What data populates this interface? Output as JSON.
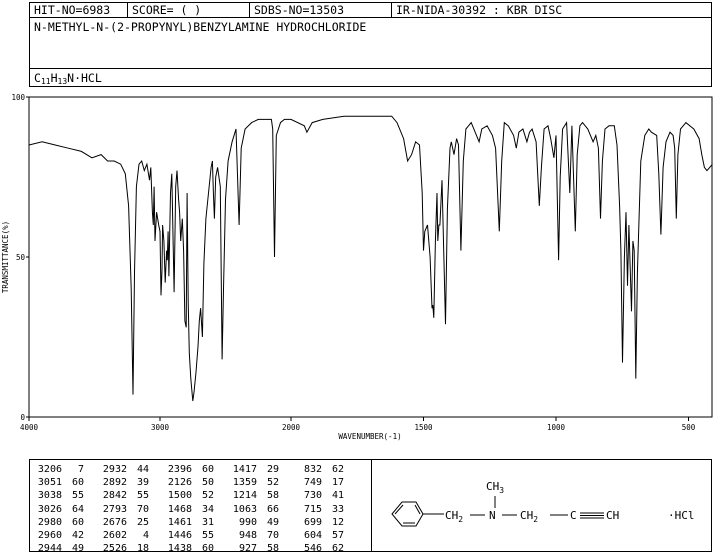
{
  "header": {
    "hit": "HIT-NO=6983",
    "score": "SCORE=  (   )",
    "sdbs": "SDBS-NO=13503",
    "ir": "IR-NIDA-30392 : KBR DISC"
  },
  "compound_name": "N-METHYL-N-(2-PROPYNYL)BENZYLAMINE HYDROCHLORIDE",
  "formula": {
    "c": "C",
    "c_n": "11",
    "h": "H",
    "h_n": "13",
    "rest": "N·HCL"
  },
  "structure": {
    "ch3": "CH",
    "ch3_sub": "3",
    "ch2a": "CH",
    "ch2a_sub": "2",
    "n": "N",
    "ch2b": "CH",
    "ch2b_sub": "2",
    "c": "C",
    "ch": "CH",
    "salt": "·HCl"
  },
  "chart_data": {
    "type": "line",
    "xlabel": "WAVENUMBER(-1)",
    "ylabel": "TRANSMITTANCE(%)",
    "x_ticks": [
      "4000",
      "3000",
      "2000",
      "1500",
      "1000",
      "500"
    ],
    "y_ticks": [
      "100",
      "50",
      "0"
    ],
    "xlim": [
      4000,
      400
    ],
    "ylim": [
      0,
      100
    ],
    "x_scale": "piecewise linear, break at 2000",
    "grid": false,
    "series": [
      {
        "values": [
          [
            4000,
            85
          ],
          [
            3900,
            86
          ],
          [
            3800,
            85
          ],
          [
            3700,
            84
          ],
          [
            3600,
            83
          ],
          [
            3520,
            81
          ],
          [
            3450,
            82
          ],
          [
            3400,
            80
          ],
          [
            3350,
            80
          ],
          [
            3300,
            79
          ],
          [
            3265,
            76
          ],
          [
            3240,
            66
          ],
          [
            3220,
            40
          ],
          [
            3206,
            7
          ],
          [
            3195,
            45
          ],
          [
            3180,
            72
          ],
          [
            3160,
            79
          ],
          [
            3140,
            80
          ],
          [
            3120,
            77
          ],
          [
            3100,
            79
          ],
          [
            3080,
            74
          ],
          [
            3070,
            78
          ],
          [
            3058,
            64
          ],
          [
            3051,
            60
          ],
          [
            3045,
            72
          ],
          [
            3038,
            55
          ],
          [
            3026,
            64
          ],
          [
            3010,
            60
          ],
          [
            3000,
            58
          ],
          [
            2992,
            38
          ],
          [
            2985,
            46
          ],
          [
            2980,
            60
          ],
          [
            2970,
            55
          ],
          [
            2960,
            42
          ],
          [
            2950,
            52
          ],
          [
            2944,
            49
          ],
          [
            2938,
            58
          ],
          [
            2932,
            44
          ],
          [
            2920,
            70
          ],
          [
            2910,
            76
          ],
          [
            2892,
            39
          ],
          [
            2880,
            72
          ],
          [
            2870,
            77
          ],
          [
            2858,
            68
          ],
          [
            2850,
            64
          ],
          [
            2842,
            55
          ],
          [
            2830,
            62
          ],
          [
            2820,
            52
          ],
          [
            2810,
            30
          ],
          [
            2800,
            28
          ],
          [
            2793,
            70
          ],
          [
            2785,
            36
          ],
          [
            2776,
            20
          ],
          [
            2765,
            12
          ],
          [
            2750,
            5
          ],
          [
            2740,
            8
          ],
          [
            2725,
            14
          ],
          [
            2710,
            22
          ],
          [
            2700,
            30
          ],
          [
            2690,
            34
          ],
          [
            2676,
            25
          ],
          [
            2665,
            48
          ],
          [
            2650,
            62
          ],
          [
            2630,
            70
          ],
          [
            2610,
            78
          ],
          [
            2600,
            80
          ],
          [
            2592,
            70
          ],
          [
            2585,
            62
          ],
          [
            2575,
            75
          ],
          [
            2560,
            78
          ],
          [
            2540,
            72
          ],
          [
            2526,
            18
          ],
          [
            2515,
            40
          ],
          [
            2500,
            68
          ],
          [
            2480,
            80
          ],
          [
            2450,
            86
          ],
          [
            2420,
            90
          ],
          [
            2396,
            60
          ],
          [
            2380,
            84
          ],
          [
            2350,
            90
          ],
          [
            2300,
            92
          ],
          [
            2250,
            93
          ],
          [
            2200,
            93
          ],
          [
            2150,
            93
          ],
          [
            2140,
            90
          ],
          [
            2126,
            50
          ],
          [
            2112,
            88
          ],
          [
            2080,
            92
          ],
          [
            2050,
            93
          ],
          [
            2000,
            93
          ],
          [
            1950,
            91
          ],
          [
            1940,
            89
          ],
          [
            1920,
            92
          ],
          [
            1880,
            93
          ],
          [
            1800,
            94
          ],
          [
            1700,
            94
          ],
          [
            1650,
            94
          ],
          [
            1620,
            94
          ],
          [
            1600,
            92
          ],
          [
            1575,
            87
          ],
          [
            1560,
            80
          ],
          [
            1545,
            82
          ],
          [
            1530,
            86
          ],
          [
            1515,
            85
          ],
          [
            1505,
            70
          ],
          [
            1500,
            52
          ],
          [
            1495,
            58
          ],
          [
            1485,
            60
          ],
          [
            1475,
            50
          ],
          [
            1468,
            34
          ],
          [
            1465,
            35
          ],
          [
            1461,
            31
          ],
          [
            1455,
            55
          ],
          [
            1449,
            70
          ],
          [
            1446,
            55
          ],
          [
            1442,
            60
          ],
          [
            1438,
            60
          ],
          [
            1430,
            74
          ],
          [
            1417,
            29
          ],
          [
            1410,
            65
          ],
          [
            1400,
            84
          ],
          [
            1395,
            86
          ],
          [
            1385,
            82
          ],
          [
            1375,
            87
          ],
          [
            1368,
            85
          ],
          [
            1359,
            52
          ],
          [
            1350,
            80
          ],
          [
            1340,
            90
          ],
          [
            1320,
            92
          ],
          [
            1300,
            88
          ],
          [
            1290,
            86
          ],
          [
            1280,
            90
          ],
          [
            1260,
            91
          ],
          [
            1240,
            88
          ],
          [
            1228,
            84
          ],
          [
            1214,
            58
          ],
          [
            1205,
            80
          ],
          [
            1195,
            92
          ],
          [
            1180,
            91
          ],
          [
            1160,
            88
          ],
          [
            1150,
            84
          ],
          [
            1140,
            89
          ],
          [
            1125,
            90
          ],
          [
            1110,
            86
          ],
          [
            1100,
            89
          ],
          [
            1090,
            90
          ],
          [
            1075,
            86
          ],
          [
            1063,
            66
          ],
          [
            1055,
            78
          ],
          [
            1045,
            90
          ],
          [
            1030,
            91
          ],
          [
            1020,
            87
          ],
          [
            1008,
            81
          ],
          [
            1000,
            88
          ],
          [
            990,
            49
          ],
          [
            984,
            75
          ],
          [
            975,
            90
          ],
          [
            960,
            92
          ],
          [
            948,
            70
          ],
          [
            940,
            91
          ],
          [
            927,
            58
          ],
          [
            920,
            82
          ],
          [
            910,
            91
          ],
          [
            900,
            92
          ],
          [
            880,
            90
          ],
          [
            860,
            86
          ],
          [
            850,
            88
          ],
          [
            840,
            84
          ],
          [
            832,
            62
          ],
          [
            825,
            80
          ],
          [
            815,
            90
          ],
          [
            800,
            91
          ],
          [
            780,
            91
          ],
          [
            770,
            85
          ],
          [
            760,
            66
          ],
          [
            755,
            52
          ],
          [
            749,
            17
          ],
          [
            742,
            50
          ],
          [
            736,
            64
          ],
          [
            730,
            41
          ],
          [
            725,
            60
          ],
          [
            715,
            33
          ],
          [
            710,
            55
          ],
          [
            705,
            52
          ],
          [
            699,
            12
          ],
          [
            693,
            45
          ],
          [
            680,
            80
          ],
          [
            665,
            88
          ],
          [
            650,
            90
          ],
          [
            640,
            89
          ],
          [
            620,
            88
          ],
          [
            612,
            76
          ],
          [
            604,
            57
          ],
          [
            596,
            78
          ],
          [
            585,
            86
          ],
          [
            570,
            89
          ],
          [
            558,
            88
          ],
          [
            552,
            84
          ],
          [
            546,
            62
          ],
          [
            540,
            82
          ],
          [
            530,
            90
          ],
          [
            510,
            92
          ],
          [
            480,
            90
          ],
          [
            460,
            87
          ],
          [
            450,
            82
          ],
          [
            440,
            78
          ],
          [
            430,
            77
          ],
          [
            420,
            78
          ],
          [
            410,
            79
          ]
        ]
      }
    ],
    "peaks": [
      [
        "3206",
        "7"
      ],
      [
        "3051",
        "60"
      ],
      [
        "3038",
        "55"
      ],
      [
        "3026",
        "64"
      ],
      [
        "2980",
        "60"
      ],
      [
        "2960",
        "42"
      ],
      [
        "2944",
        "49"
      ],
      [
        "2932",
        "44"
      ],
      [
        "2892",
        "39"
      ],
      [
        "2842",
        "55"
      ],
      [
        "2793",
        "70"
      ],
      [
        "2676",
        "25"
      ],
      [
        "2602",
        "4"
      ],
      [
        "2526",
        "18"
      ],
      [
        "2396",
        "60"
      ],
      [
        "2126",
        "50"
      ],
      [
        "1500",
        "52"
      ],
      [
        "1468",
        "34"
      ],
      [
        "1461",
        "31"
      ],
      [
        "1446",
        "55"
      ],
      [
        "1438",
        "60"
      ],
      [
        "1417",
        "29"
      ],
      [
        "1359",
        "52"
      ],
      [
        "1214",
        "58"
      ],
      [
        "1063",
        "66"
      ],
      [
        "990",
        "49"
      ],
      [
        "948",
        "70"
      ],
      [
        "927",
        "58"
      ],
      [
        "832",
        "62"
      ],
      [
        "749",
        "17"
      ],
      [
        "730",
        "41"
      ],
      [
        "715",
        "33"
      ],
      [
        "699",
        "12"
      ],
      [
        "604",
        "57"
      ],
      [
        "546",
        "62"
      ]
    ]
  }
}
